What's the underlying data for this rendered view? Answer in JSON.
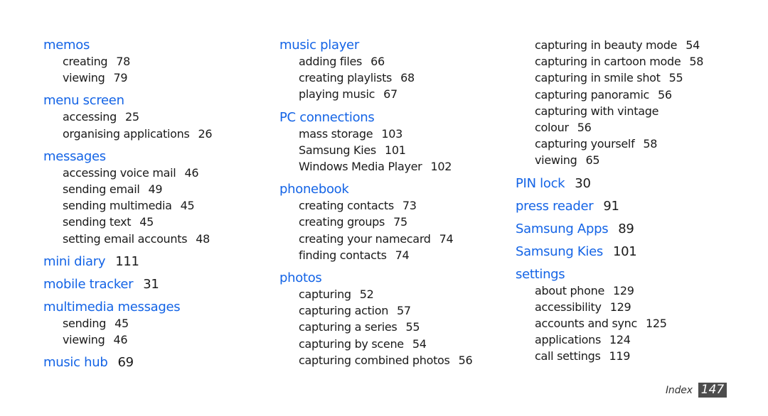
{
  "colors": {
    "heading": "#1464e6",
    "text": "#1a1a1a",
    "badge_bg": "#4d4d4d"
  },
  "columns": [
    {
      "entries": [
        {
          "heading": "memos",
          "page": "",
          "subs": [
            {
              "label": "creating",
              "page": "78"
            },
            {
              "label": "viewing",
              "page": "79"
            }
          ]
        },
        {
          "heading": "menu screen",
          "page": "",
          "subs": [
            {
              "label": "accessing",
              "page": "25"
            },
            {
              "label": "organising applications",
              "page": "26"
            }
          ]
        },
        {
          "heading": "messages",
          "page": "",
          "subs": [
            {
              "label": "accessing voice mail",
              "page": "46"
            },
            {
              "label": "sending email",
              "page": "49"
            },
            {
              "label": "sending multimedia",
              "page": "45"
            },
            {
              "label": "sending text",
              "page": "45"
            },
            {
              "label": "setting email accounts",
              "page": "48"
            }
          ]
        },
        {
          "heading": "mini diary",
          "page": "111",
          "subs": []
        },
        {
          "heading": "mobile tracker",
          "page": "31",
          "subs": []
        },
        {
          "heading": "multimedia messages",
          "page": "",
          "subs": [
            {
              "label": "sending",
              "page": "45"
            },
            {
              "label": "viewing",
              "page": "46"
            }
          ]
        },
        {
          "heading": "music hub",
          "page": "69",
          "subs": []
        }
      ]
    },
    {
      "entries": [
        {
          "heading": "music player",
          "page": "",
          "subs": [
            {
              "label": "adding files",
              "page": "66"
            },
            {
              "label": "creating playlists",
              "page": "68"
            },
            {
              "label": "playing music",
              "page": "67"
            }
          ]
        },
        {
          "heading": "PC connections",
          "page": "",
          "subs": [
            {
              "label": "mass storage",
              "page": "103"
            },
            {
              "label": "Samsung Kies",
              "page": "101"
            },
            {
              "label": "Windows Media Player",
              "page": "102"
            }
          ]
        },
        {
          "heading": "phonebook",
          "page": "",
          "subs": [
            {
              "label": "creating contacts",
              "page": "73"
            },
            {
              "label": "creating groups",
              "page": "75"
            },
            {
              "label": "creating your namecard",
              "page": "74"
            },
            {
              "label": "finding contacts",
              "page": "74"
            }
          ]
        },
        {
          "heading": "photos",
          "page": "",
          "subs": [
            {
              "label": "capturing",
              "page": "52"
            },
            {
              "label": "capturing action",
              "page": "57"
            },
            {
              "label": "capturing a series",
              "page": "55"
            },
            {
              "label": "capturing by scene",
              "page": "54"
            },
            {
              "label": "capturing combined photos",
              "page": "56"
            }
          ]
        }
      ]
    },
    {
      "entries": [
        {
          "heading": "",
          "page": "",
          "subs": [
            {
              "label": "capturing in beauty mode",
              "page": "54"
            },
            {
              "label": "capturing in cartoon mode",
              "page": "58"
            },
            {
              "label": "capturing in smile shot",
              "page": "55"
            },
            {
              "label": "capturing panoramic",
              "page": "56"
            },
            {
              "label": "capturing with vintage",
              "page": ""
            },
            {
              "label": "colour",
              "page": "56"
            },
            {
              "label": "capturing yourself",
              "page": "58"
            },
            {
              "label": "viewing",
              "page": "65"
            }
          ]
        },
        {
          "heading": "PIN lock",
          "page": "30",
          "subs": []
        },
        {
          "heading": "press reader",
          "page": "91",
          "subs": []
        },
        {
          "heading": "Samsung Apps",
          "page": "89",
          "subs": []
        },
        {
          "heading": "Samsung Kies",
          "page": "101",
          "subs": []
        },
        {
          "heading": "settings",
          "page": "",
          "subs": [
            {
              "label": "about phone",
              "page": "129"
            },
            {
              "label": "accessibility",
              "page": "129"
            },
            {
              "label": "accounts and sync",
              "page": "125"
            },
            {
              "label": "applications",
              "page": "124"
            },
            {
              "label": "call settings",
              "page": "119"
            }
          ]
        }
      ]
    }
  ],
  "footer": {
    "label": "Index",
    "page_number": "147"
  }
}
